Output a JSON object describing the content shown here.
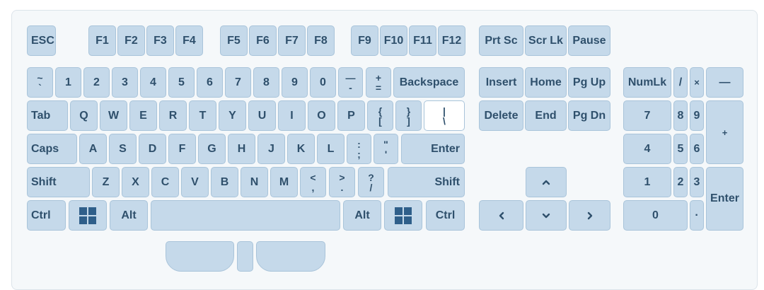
{
  "keyboard": {
    "function_row": {
      "esc": "ESC",
      "f1": "F1",
      "f2": "F2",
      "f3": "F3",
      "f4": "F4",
      "f5": "F5",
      "f6": "F6",
      "f7": "F7",
      "f8": "F8",
      "f9": "F9",
      "f10": "F10",
      "f11": "F11",
      "f12": "F12",
      "prt_sc": "Prt Sc",
      "scr_lk": "Scr Lk",
      "pause": "Pause"
    },
    "number_row": {
      "tilde_top": "~",
      "tilde_bottom": "`",
      "n1": "1",
      "n2": "2",
      "n3": "3",
      "n4": "4",
      "n5": "5",
      "n6": "6",
      "n7": "7",
      "n8": "8",
      "n9": "9",
      "n0": "0",
      "minus_top": "—",
      "minus_bottom": "-",
      "equals_top": "+",
      "equals_bottom": "=",
      "backspace": "Backspace"
    },
    "qwerty_row": {
      "tab": "Tab",
      "q": "Q",
      "w": "W",
      "e": "E",
      "r": "R",
      "t": "T",
      "y": "Y",
      "u": "U",
      "i": "I",
      "o": "O",
      "p": "P",
      "lbracket_top": "{",
      "lbracket_bottom": "[",
      "rbracket_top": "}",
      "rbracket_bottom": "]",
      "backslash_top": "|",
      "backslash_bottom": "\\"
    },
    "home_row": {
      "caps": "Caps",
      "a": "A",
      "s": "S",
      "d": "D",
      "f": "F",
      "g": "G",
      "h": "H",
      "j": "J",
      "k": "K",
      "l": "L",
      "semicolon_top": ":",
      "semicolon_bottom": ";",
      "quote_top": "\"",
      "quote_bottom": "'",
      "enter": "Enter"
    },
    "shift_row": {
      "lshift": "Shift",
      "z": "Z",
      "x": "X",
      "c": "C",
      "v": "V",
      "b": "B",
      "n": "N",
      "m": "M",
      "comma_top": "<",
      "comma_bottom": ",",
      "period_top": ">",
      "period_bottom": ".",
      "slash_top": "?",
      "slash_bottom": "/",
      "rshift": "Shift"
    },
    "bottom_row": {
      "lctrl": "Ctrl",
      "lalt": "Alt",
      "ralt": "Alt",
      "rctrl": "Ctrl",
      "windows_icon": "windows-logo"
    },
    "navigation": {
      "insert": "Insert",
      "home": "Home",
      "pg_up": "Pg Up",
      "delete": "Delete",
      "end": "End",
      "pg_dn": "Pg Dn",
      "arrow_icons": [
        "arrow-up",
        "arrow-left",
        "arrow-down",
        "arrow-right"
      ]
    },
    "numpad": {
      "numlk": "NumLk",
      "divide": "/",
      "multiply": "×",
      "minus": "—",
      "n7": "7",
      "n8": "8",
      "n9": "9",
      "plus": "+",
      "n4": "4",
      "n5": "5",
      "n6": "6",
      "n1": "1",
      "n2": "2",
      "n3": "3",
      "enter": "Enter",
      "n0": "0",
      "decimal": "·"
    }
  },
  "colors": {
    "key_fill": "#c5d9ea",
    "key_border": "#a9c4da",
    "key_text": "#2f506c",
    "key_highlight": "#ffffff",
    "board_background": "#f5f8fa"
  }
}
